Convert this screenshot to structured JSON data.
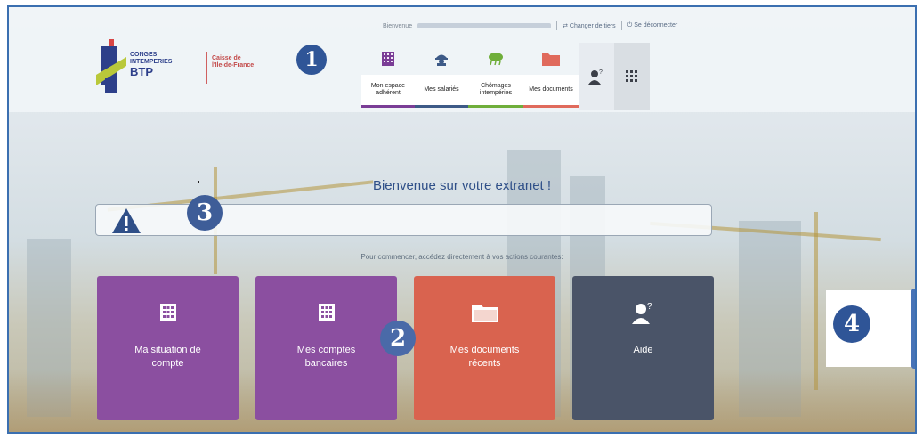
{
  "header": {
    "welcome_label": "Bienvenue",
    "change_tiers": "Changer de tiers",
    "logout": "Se déconnecter"
  },
  "logo": {
    "brand_line1": "CONGES",
    "brand_line2": "INTEMPERIES",
    "brand_line3": "BTP",
    "caisse_line1": "Caisse de",
    "caisse_line2": "l'Ile-de-France"
  },
  "callouts": {
    "one": "1",
    "two": "2",
    "three": "3",
    "four": "4"
  },
  "nav": {
    "items": [
      {
        "label": "Mon espace adhérent",
        "icon": "building-icon",
        "color": "#7a3d96"
      },
      {
        "label": "Mes salariés",
        "icon": "worker-icon",
        "color": "#3d5a87"
      },
      {
        "label": "Chômages intempéries",
        "icon": "weather-icon",
        "color": "#6fae3a"
      },
      {
        "label": "Mes documents",
        "icon": "folder-icon",
        "color": "#e06a5c"
      }
    ],
    "help_icon": "help-user-icon",
    "apps_icon": "grid-icon"
  },
  "main": {
    "title": "Bienvenue sur votre extranet !",
    "subtitle": "Pour commencer, accédez directement à vos actions courantes:"
  },
  "tiles": [
    {
      "label": "Ma situation de compte",
      "icon": "building-icon",
      "color": "#8b4fa0"
    },
    {
      "label": "Mes comptes bancaires",
      "icon": "building-icon",
      "color": "#8b4fa0"
    },
    {
      "label": "Mes documents récents",
      "icon": "folder-icon",
      "color": "#d9634f"
    },
    {
      "label": "Aide",
      "icon": "help-user-icon",
      "color": "#4a5468"
    }
  ]
}
